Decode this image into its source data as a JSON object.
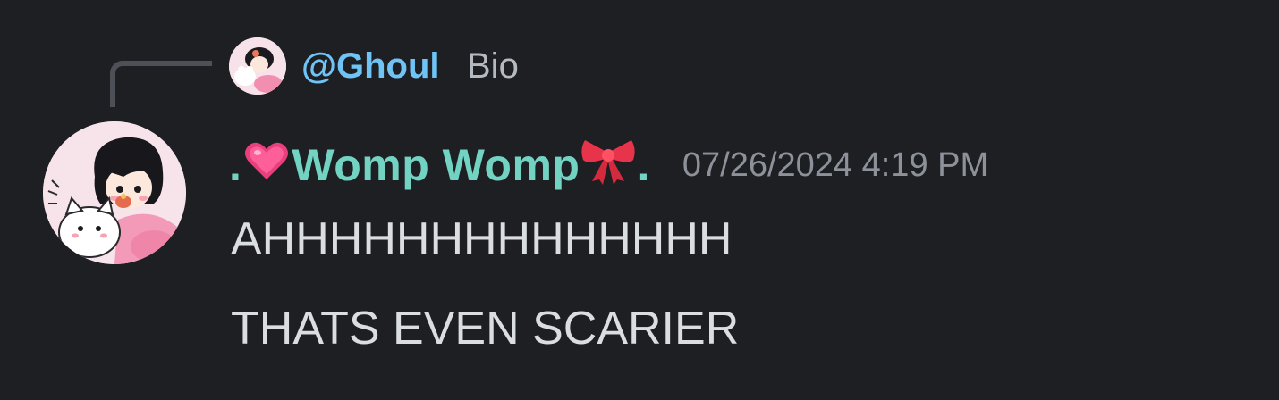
{
  "reply": {
    "username": "@Ghoul",
    "content": "Bio",
    "avatar_icon": "avatar-icon"
  },
  "message": {
    "author": {
      "prefix": ".",
      "emoji_before": "sparkling-heart-icon",
      "name": "Womp Womp",
      "emoji_after": "ribbon-icon",
      "suffix": ".",
      "color": "#73d3c2"
    },
    "timestamp": "07/26/2024 4:19 PM",
    "lines": [
      "AHHHHHHHHHHHHHH",
      "THATS EVEN SCARIER"
    ]
  },
  "colors": {
    "background": "#1e1f23",
    "reply_username": "#6fc3f5",
    "timestamp": "#8d9199",
    "text": "#dbdee1"
  }
}
